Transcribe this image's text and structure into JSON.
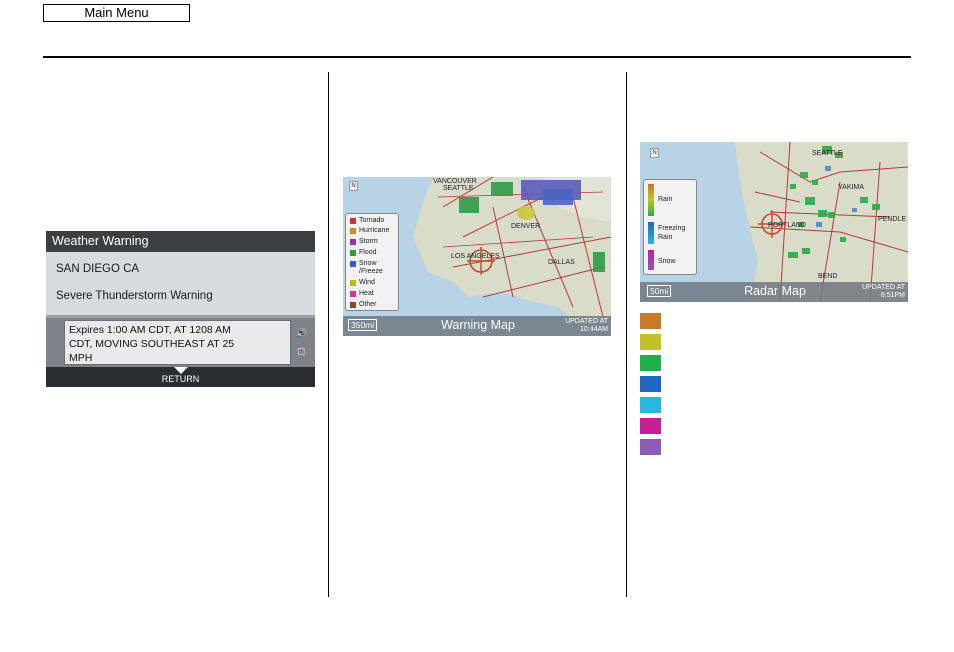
{
  "nav": {
    "main_menu_label": "Main Menu"
  },
  "weather_warning": {
    "title": "Weather Warning",
    "location": "SAN DIEGO CA",
    "warning_type": "Severe Thunderstorm Warning",
    "message_line1": "Expires 1:00 AM CDT, AT 1208 AM",
    "message_line2": "CDT, MOVING SOUTHEAST AT 25",
    "message_line3": "MPH",
    "return_label": "RETURN"
  },
  "warning_map": {
    "title": "Warning Map",
    "scale": "350mi",
    "updated_line1": "UPDATED AT",
    "updated_line2": "10:44AM",
    "city_labels": [
      "VANCOUVER",
      "SEATTLE",
      "DENVER",
      "LOS ANGELES",
      "DALLAS"
    ],
    "legend": [
      {
        "label": "Tornado",
        "color": "#c8383a"
      },
      {
        "label": "Hurricane",
        "color": "#d08a2a"
      },
      {
        "label": "Storm",
        "color": "#8a3aa0"
      },
      {
        "label": "Flood",
        "color": "#2e9a46"
      },
      {
        "label": "Snow",
        "color": "#3a5ac0"
      },
      {
        "label": "/Freeze",
        "color": ""
      },
      {
        "label": "Wind",
        "color": "#b8b82a"
      },
      {
        "label": "Heat",
        "color": "#c83aa0"
      },
      {
        "label": "Other",
        "color": "#8a4a2a"
      }
    ]
  },
  "radar_map": {
    "title": "Radar Map",
    "scale": "50mi",
    "updated_line1": "UPDATED AT",
    "updated_line2": "6:51PM",
    "city_labels": [
      "SEATTLE",
      "YAKIMA",
      "PORTLAND",
      "BEND",
      "PENDLE"
    ],
    "legend": [
      {
        "label": "Rain"
      },
      {
        "label": "Freezing"
      },
      {
        "label": "Rain"
      },
      {
        "label": "Snow"
      }
    ]
  },
  "color_swatches": [
    "#c77a2a",
    "#c2c228",
    "#1fb04a",
    "#2066c0",
    "#27b8dc",
    "#c81e9a",
    "#8e5cb6"
  ]
}
